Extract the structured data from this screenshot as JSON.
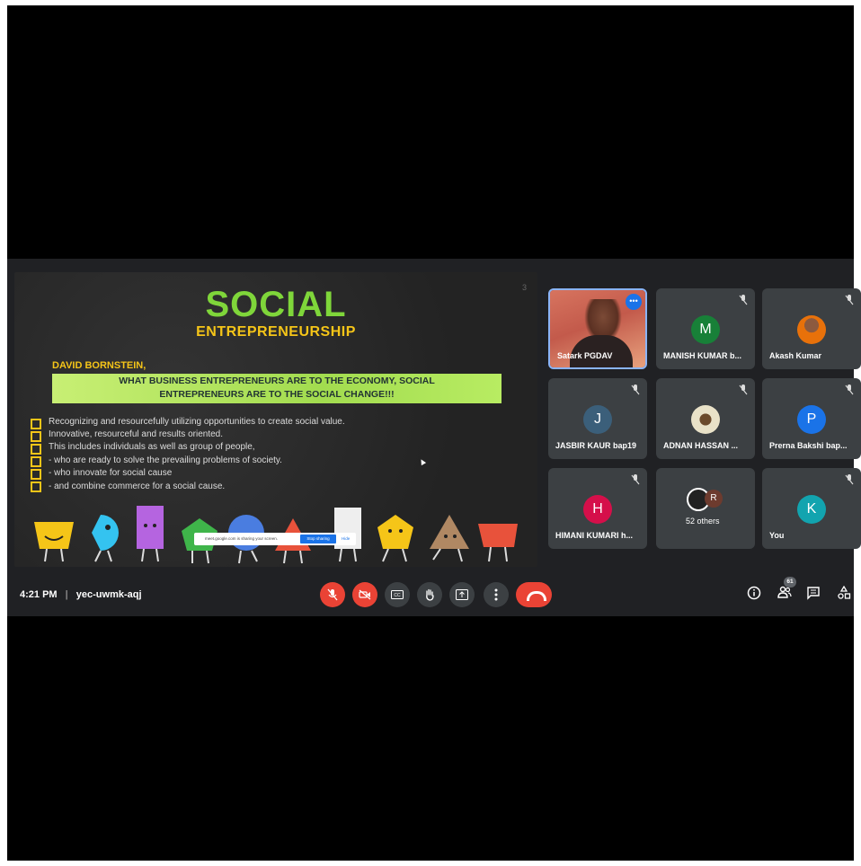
{
  "slide": {
    "page_number": "3",
    "title": "SOCIAL",
    "subtitle": "ENTREPRENEURSHIP",
    "author": "DAVID BORNSTEIN,",
    "quote_line1": "WHAT BUSINESS ENTREPRENEURS ARE TO THE ECONOMY, SOCIAL",
    "quote_line2": "ENTREPRENEURS ARE TO THE SOCIAL CHANGE!!!",
    "bullets": [
      "Recognizing and resourcefully utilizing opportunities to create social value.",
      "Innovative, resourceful and results oriented.",
      "This includes individuals as well as group of people,",
      "- who are ready to solve the prevailing problems of society.",
      "- who innovate for social cause",
      "- and combine commerce for a social cause."
    ],
    "share_bar": {
      "text": "meet.google.com is sharing your screen.",
      "stop_label": "Stop sharing",
      "hide_label": "Hide"
    }
  },
  "participants": [
    {
      "name": "Satark PGDAV",
      "initial": "",
      "color": "",
      "type": "video"
    },
    {
      "name": "MANISH KUMAR b...",
      "initial": "M",
      "color": "#188038",
      "type": "letter"
    },
    {
      "name": "Akash Kumar",
      "initial": "",
      "color": "#e8710a",
      "type": "photo"
    },
    {
      "name": "JASBIR KAUR bap19",
      "initial": "J",
      "color": "#3b5f7a",
      "type": "letter"
    },
    {
      "name": "ADNAN HASSAN ...",
      "initial": "",
      "color": "#e9e2c8",
      "type": "photo"
    },
    {
      "name": "Prerna Bakshi bap...",
      "initial": "P",
      "color": "#1a73e8",
      "type": "letter"
    },
    {
      "name": "HIMANI KUMARI h...",
      "initial": "H",
      "color": "#d50f4a",
      "type": "letter"
    },
    {
      "name": "52 others",
      "initial": "R",
      "color": "#6d3b2e",
      "type": "others"
    },
    {
      "name": "You",
      "initial": "K",
      "color": "#12a4af",
      "type": "letter"
    }
  ],
  "bottom_bar": {
    "time": "4:21 PM",
    "separator": "|",
    "meeting_code": "yec-uwmk-aqj",
    "people_count": "61"
  },
  "colors": {
    "meet_bg": "#202124",
    "tile_bg": "#3c4043",
    "red": "#ea4335",
    "accent": "#8ab4f8"
  }
}
